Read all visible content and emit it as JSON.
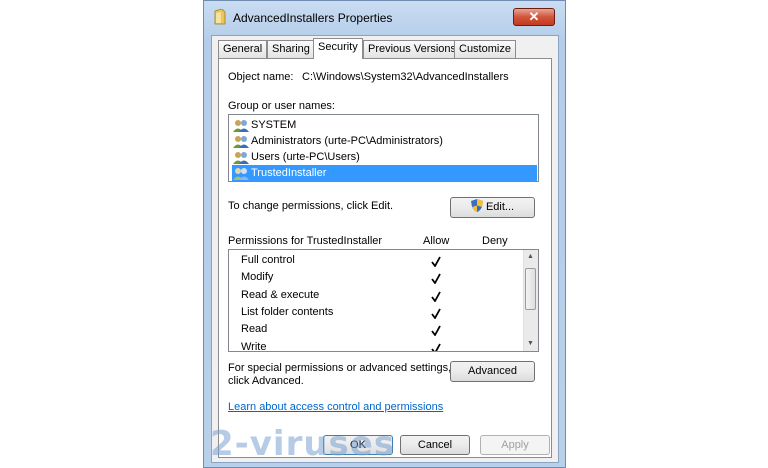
{
  "window": {
    "title": "AdvancedInstallers Properties",
    "close_label": "✕"
  },
  "tabs": [
    {
      "label": "General"
    },
    {
      "label": "Sharing"
    },
    {
      "label": "Security"
    },
    {
      "label": "Previous Versions"
    },
    {
      "label": "Customize"
    }
  ],
  "object": {
    "label": "Object name:",
    "value": "C:\\Windows\\System32\\AdvancedInstallers"
  },
  "groups": {
    "label": "Group or user names:",
    "items": [
      {
        "label": "SYSTEM"
      },
      {
        "label": "Administrators (urte-PC\\Administrators)"
      },
      {
        "label": "Users (urte-PC\\Users)"
      },
      {
        "label": "TrustedInstaller",
        "selected": true
      }
    ]
  },
  "change": {
    "text": "To change permissions, click Edit.",
    "edit_label": "Edit..."
  },
  "permissions": {
    "header": "Permissions for TrustedInstaller",
    "allow": "Allow",
    "deny": "Deny",
    "rows": [
      {
        "label": "Full control",
        "allow": true,
        "deny": false
      },
      {
        "label": "Modify",
        "allow": true,
        "deny": false
      },
      {
        "label": "Read & execute",
        "allow": true,
        "deny": false
      },
      {
        "label": "List folder contents",
        "allow": true,
        "deny": false
      },
      {
        "label": "Read",
        "allow": true,
        "deny": false
      },
      {
        "label": "Write",
        "allow": true,
        "deny": false
      }
    ]
  },
  "special": {
    "line1": "For special permissions or advanced settings,",
    "line2": "click Advanced.",
    "advanced_label": "Advanced"
  },
  "learn_link": "Learn about access control and permissions",
  "footer": {
    "ok": "OK",
    "cancel": "Cancel",
    "apply": "Apply"
  },
  "watermark": "2-viruses"
}
